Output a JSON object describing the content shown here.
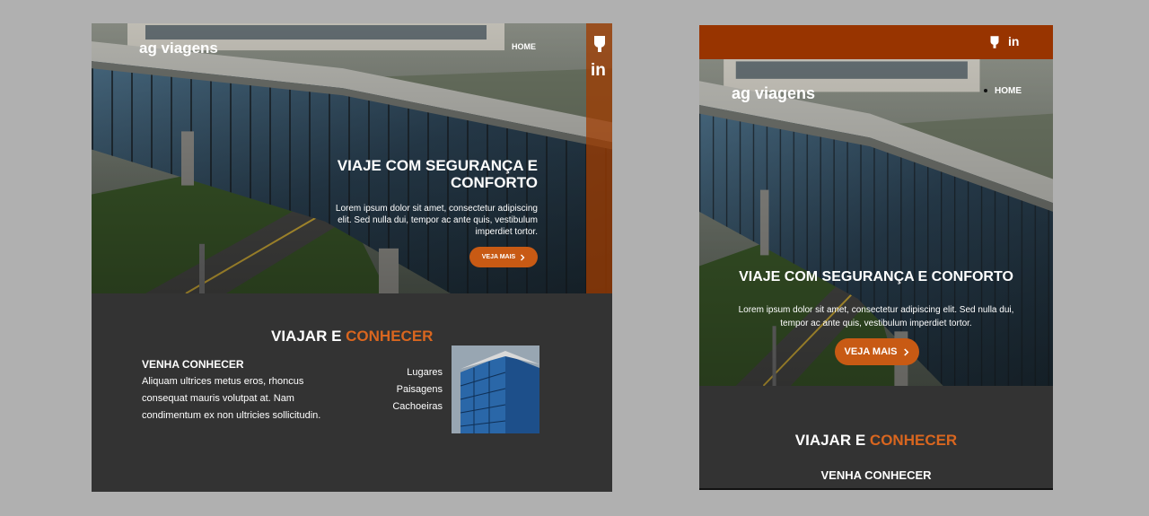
{
  "brand": {
    "logo": "ag viagens"
  },
  "nav": {
    "home": "HOME"
  },
  "social": {
    "icons": [
      "github-icon",
      "linkedin-icon"
    ],
    "linkedin_glyph": "in"
  },
  "hero": {
    "title": "VIAJE COM SEGURANÇA E CONFORTO",
    "text": "Lorem ipsum dolor sit amet, consectetur adipiscing elit. Sed nulla dui, tempor ac ante quis, vestibulum imperdiet tortor.",
    "cta_label": "VEJA MAIS",
    "cta_icon": "chevron-right-icon"
  },
  "section": {
    "title_part1": "VIAJAR E",
    "title_part2": "CONHECER",
    "subtitle": "VENHA CONHECER",
    "text": "Aliquam ultrices metus eros, rhoncus consequat mauris volutpat at. Nam condimentum ex non ultricies sollicitudin.",
    "links": [
      "Lugares",
      "Paisagens",
      "Cachoeiras"
    ]
  },
  "colors": {
    "accent": "#d9661f",
    "button": "#c85a14",
    "mobile_topbar": "#983400",
    "section_bg": "#333333",
    "page_bg": "#b0b0b0"
  }
}
